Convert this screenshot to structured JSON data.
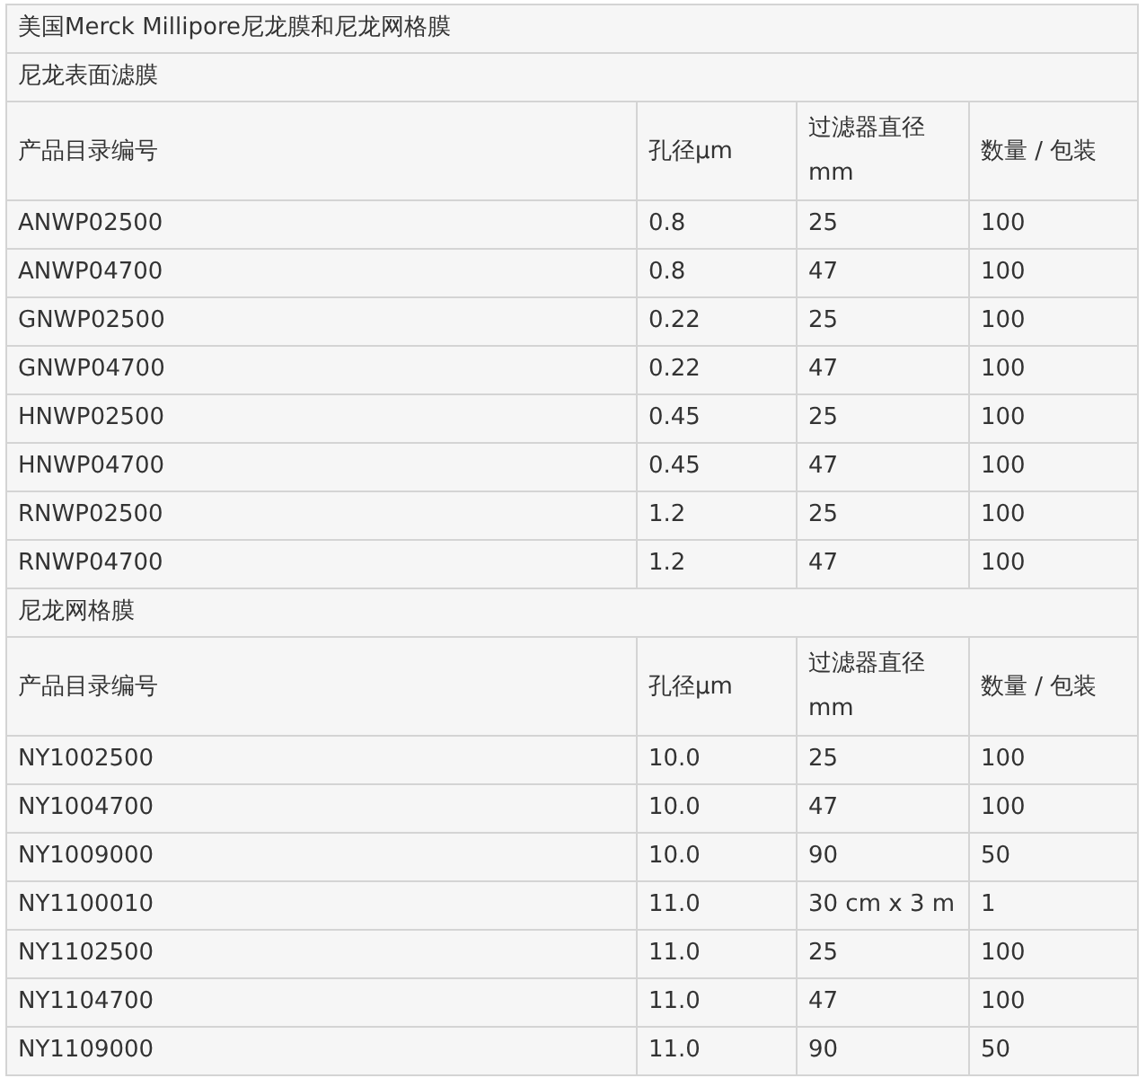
{
  "table": {
    "title": "美国Merck Millipore尼龙膜和尼龙网格膜",
    "sections": [
      {
        "title": "尼龙表面滤膜",
        "columns": [
          "产品目录编号",
          "孔径µm",
          "过滤器直径 mm",
          "数量 / 包装"
        ],
        "rows": [
          [
            "ANWP02500",
            "0.8",
            "25",
            "100"
          ],
          [
            "ANWP04700",
            "0.8",
            "47",
            "100"
          ],
          [
            "GNWP02500",
            "0.22",
            "25",
            "100"
          ],
          [
            "GNWP04700",
            "0.22",
            "47",
            "100"
          ],
          [
            "HNWP02500",
            "0.45",
            "25",
            "100"
          ],
          [
            "HNWP04700",
            "0.45",
            "47",
            "100"
          ],
          [
            "RNWP02500",
            "1.2",
            "25",
            "100"
          ],
          [
            "RNWP04700",
            "1.2",
            "47",
            "100"
          ]
        ]
      },
      {
        "title": "尼龙网格膜",
        "columns": [
          "产品目录编号",
          "孔径µm",
          "过滤器直径 mm",
          "数量 / 包装"
        ],
        "rows": [
          [
            "NY1002500",
            "10.0",
            "25",
            "100"
          ],
          [
            "NY1004700",
            "10.0",
            "47",
            "100"
          ],
          [
            "NY1009000",
            "10.0",
            "90",
            "50"
          ],
          [
            "NY1100010",
            "11.0",
            "30 cm x 3 m",
            "1"
          ],
          [
            "NY1102500",
            "11.0",
            "25",
            "100"
          ],
          [
            "NY1104700",
            "11.0",
            "47",
            "100"
          ],
          [
            "NY1109000",
            "11.0",
            "90",
            "50"
          ]
        ]
      }
    ]
  }
}
